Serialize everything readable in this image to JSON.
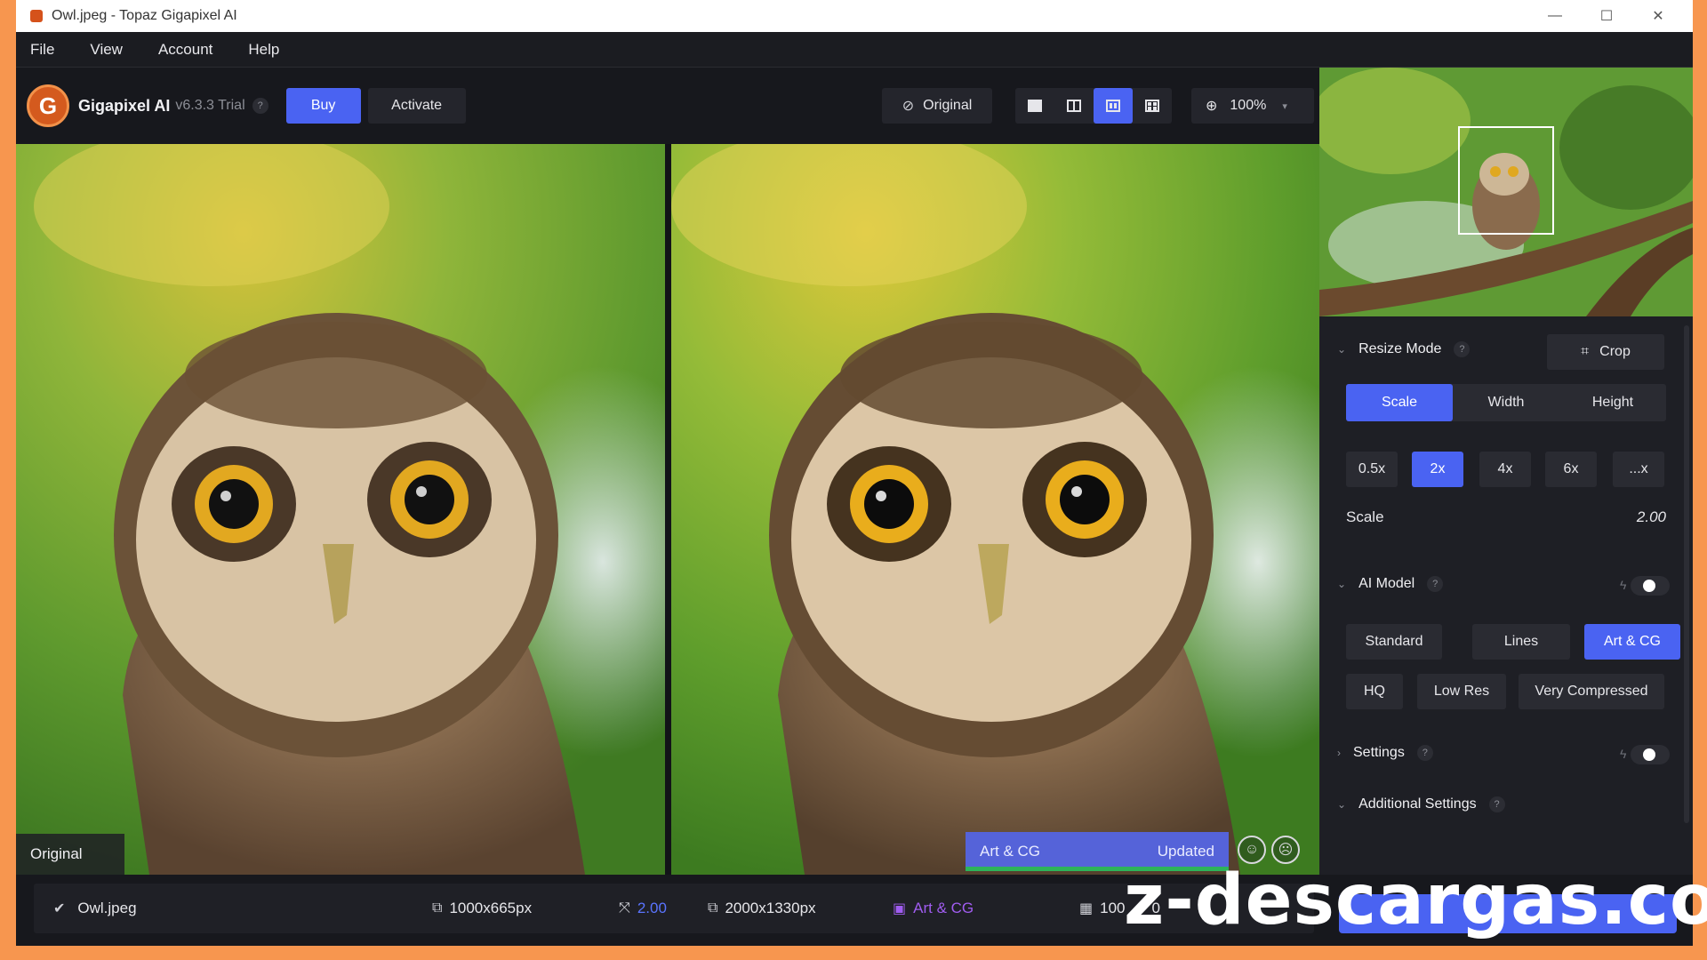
{
  "window": {
    "title": "Owl.jpeg - Topaz Gigapixel AI",
    "minimize": "—",
    "maximize": "☐",
    "close": "✕"
  },
  "menu": {
    "file": "File",
    "view": "View",
    "account": "Account",
    "help": "Help"
  },
  "toolbar": {
    "logo_letter": "G",
    "app_name": "Gigapixel AI",
    "version": "v6.3.3 Trial",
    "help": "?",
    "buy": "Buy",
    "activate": "Activate",
    "original": "Original",
    "zoom": "100%",
    "active_view": "side-by-side"
  },
  "canvas": {
    "left_label": "Original",
    "model_name": "Art & CG",
    "model_status": "Updated"
  },
  "panel": {
    "resize_mode": "Resize Mode",
    "crop": "Crop",
    "modes": [
      "Scale",
      "Width",
      "Height"
    ],
    "scales": [
      "0.5x",
      "2x",
      "4x",
      "6x",
      "...x"
    ],
    "scale_label": "Scale",
    "scale_value": "2.00",
    "ai_model": "AI Model",
    "models_row1": [
      "Standard",
      "Lines",
      "Art & CG"
    ],
    "models_row2": [
      "HQ",
      "Low Res",
      "Very Compressed"
    ],
    "settings": "Settings",
    "additional_settings": "Additional Settings",
    "help": "?"
  },
  "status": {
    "filename": "Owl.jpeg",
    "input_size": "1000x665px",
    "scale": "2.00",
    "output_size": "2000x1330px",
    "model": "Art & CG",
    "quality": "100",
    "quality_b": "0"
  },
  "watermark": "z-descargas.com",
  "colors": {
    "accent": "#4a63f2",
    "frame": "#f7964f",
    "model_purple": "#a05cf0",
    "status_green": "#2db35a"
  }
}
